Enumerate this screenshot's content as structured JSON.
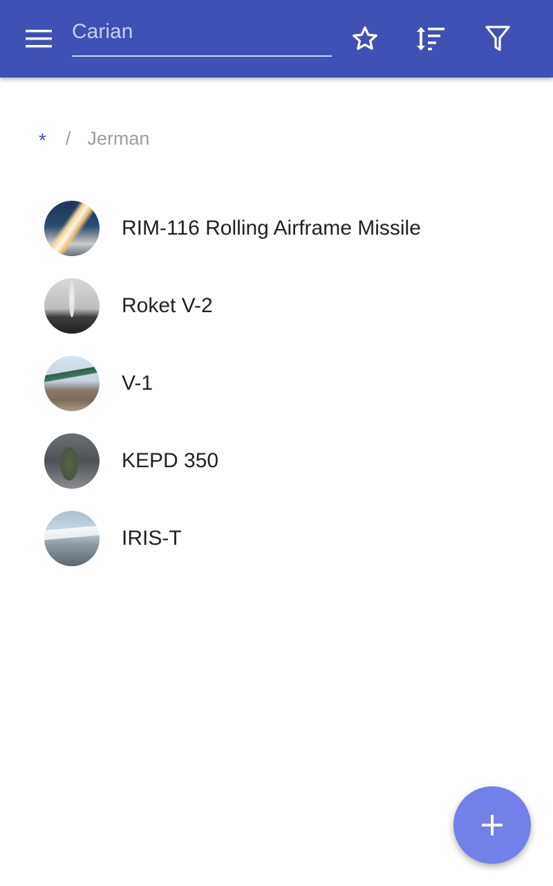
{
  "appbar": {
    "background_color": "#3f51b5",
    "menu_icon": "menu-icon",
    "search": {
      "placeholder": "Carian",
      "value": ""
    },
    "actions": [
      {
        "icon": "star-icon"
      },
      {
        "icon": "sort-icon"
      },
      {
        "icon": "filter-icon"
      }
    ]
  },
  "breadcrumb": {
    "root": "*",
    "separator": "/",
    "current": "Jerman",
    "root_color": "#3f51b5"
  },
  "list": {
    "items": [
      {
        "label": "RIM-116 Rolling Airframe Missile",
        "thumbnail": "missile-launch-photo"
      },
      {
        "label": "Roket V-2",
        "thumbnail": "v2-rocket-photo"
      },
      {
        "label": "V-1",
        "thumbnail": "v1-flying-bomb-photo"
      },
      {
        "label": "KEPD 350",
        "thumbnail": "kepd-350-photo"
      },
      {
        "label": "IRIS-T",
        "thumbnail": "iris-t-photo"
      }
    ]
  },
  "fab": {
    "icon": "plus-icon",
    "color": "#7280e8"
  }
}
